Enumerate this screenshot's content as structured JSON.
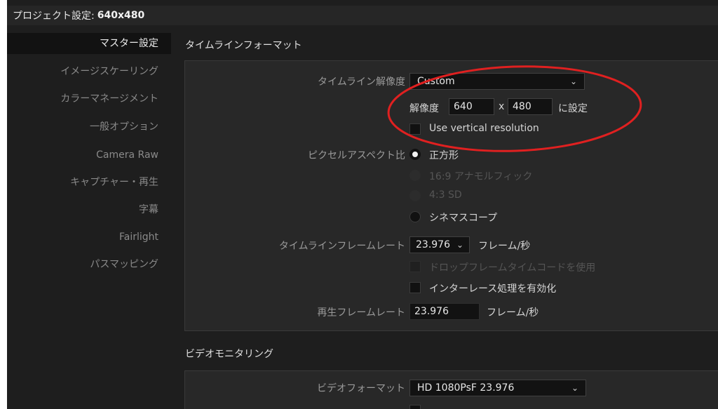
{
  "title": {
    "prefix": "プロジェクト設定:",
    "project": "640x480"
  },
  "sidebar": {
    "items": [
      {
        "label": "マスター設定"
      },
      {
        "label": "イメージスケーリング"
      },
      {
        "label": "カラーマネージメント"
      },
      {
        "label": "一般オプション"
      },
      {
        "label": "Camera Raw"
      },
      {
        "label": "キャプチャー・再生"
      },
      {
        "label": "字幕"
      },
      {
        "label": "Fairlight"
      },
      {
        "label": "パスマッピング"
      }
    ]
  },
  "timeline_format": {
    "header": "タイムラインフォーマット",
    "resolution": {
      "label": "タイムライン解像度",
      "value": "Custom",
      "size_label": "解像度",
      "width": "640",
      "separator": "x",
      "height": "480",
      "set_label": "に設定",
      "vertical_label": "Use vertical resolution"
    },
    "pixel_aspect": {
      "label": "ピクセルアスペクト比",
      "options": [
        {
          "label": "正方形"
        },
        {
          "label": "16:9 アナモルフィック"
        },
        {
          "label": "4:3 SD"
        },
        {
          "label": "シネマスコープ"
        }
      ]
    },
    "frame_rate": {
      "label": "タイムラインフレームレート",
      "value": "23.976",
      "unit": "フレーム/秒",
      "drop_frame_label": "ドロップフレームタイムコードを使用",
      "interlace_label": "インターレース処理を有効化"
    },
    "playback": {
      "label": "再生フレームレート",
      "value": "23.976",
      "unit": "フレーム/秒"
    }
  },
  "video_monitoring": {
    "header": "ビデオモニタリング",
    "format_label": "ビデオフォーマット",
    "format_value": "HD 1080PsF 23.976"
  },
  "colors": {
    "annotation": "#e02020"
  }
}
